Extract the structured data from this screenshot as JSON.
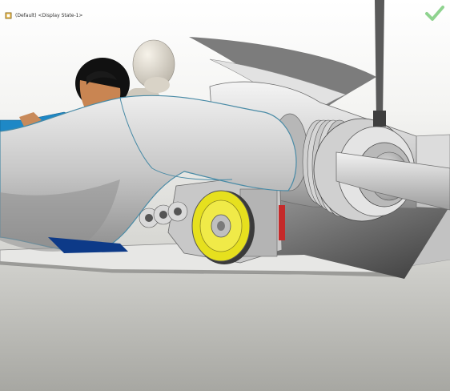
{
  "viewport": {
    "display_state_label": "(Default) <Display State-1>",
    "confirm_icon": "checkmark-icon",
    "display_state_icon": "display-state-icon",
    "colors": {
      "background_top": "#ffffff",
      "background_bottom": "#a7a7a2",
      "body_shell": "#c4c4c4",
      "flywheel": "#e6e01e",
      "confirm_check": "#8fd38f",
      "pilot_shirt": "#1e88c6",
      "pilot_hair": "#111111"
    }
  }
}
